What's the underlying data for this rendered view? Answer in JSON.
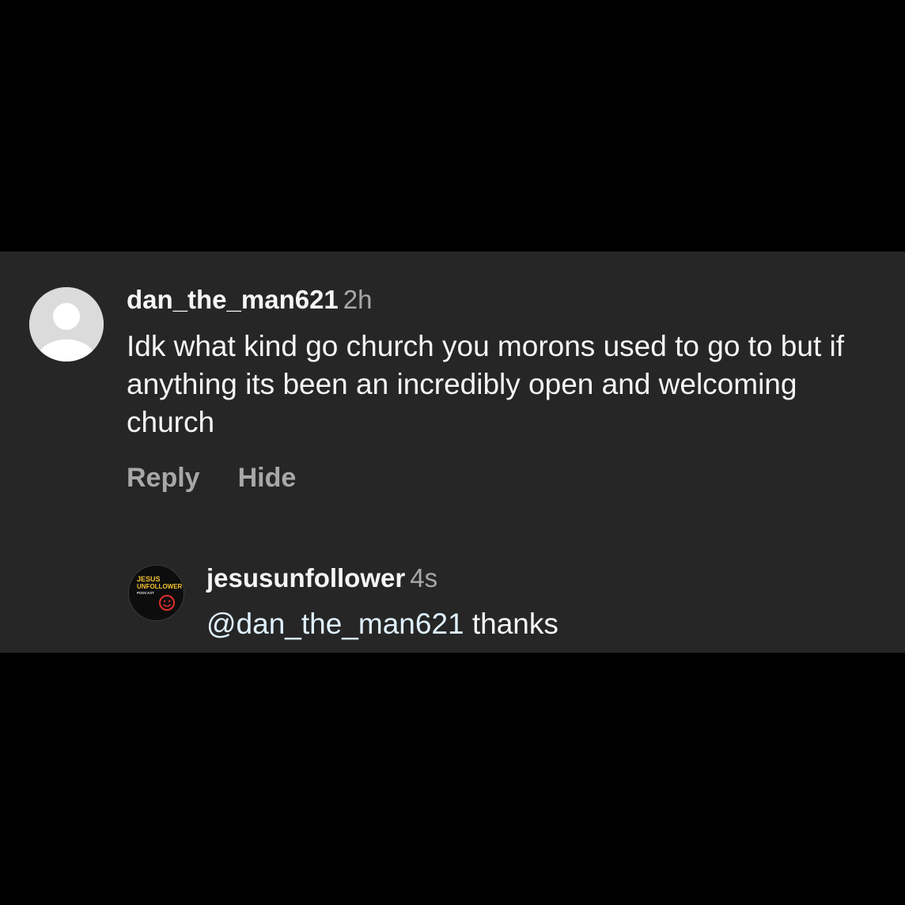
{
  "comment": {
    "username": "dan_the_man621",
    "time": "2h",
    "text": "Idk what kind go church you morons used to go to but if anything its been an incredibly open and welcoming church",
    "avatar_icon": "default-profile-icon",
    "actions": {
      "reply_label": "Reply",
      "hide_label": "Hide"
    }
  },
  "reply": {
    "username": "jesusunfollower",
    "time": "4s",
    "mention": "@dan_the_man621",
    "text": "thanks",
    "avatar": {
      "icon": "podcast-logo-icon",
      "logo_line1": "JESUS",
      "logo_line2": "UNFOLLOWER",
      "logo_line3": "PODCAST"
    }
  },
  "colors": {
    "background": "#000000",
    "panel": "#262626",
    "primary_text": "#f5f5f5",
    "secondary_text": "#a8a8a8",
    "mention": "#e0f1ff",
    "logo_yellow": "#f2c230",
    "logo_red": "#e0302a"
  }
}
